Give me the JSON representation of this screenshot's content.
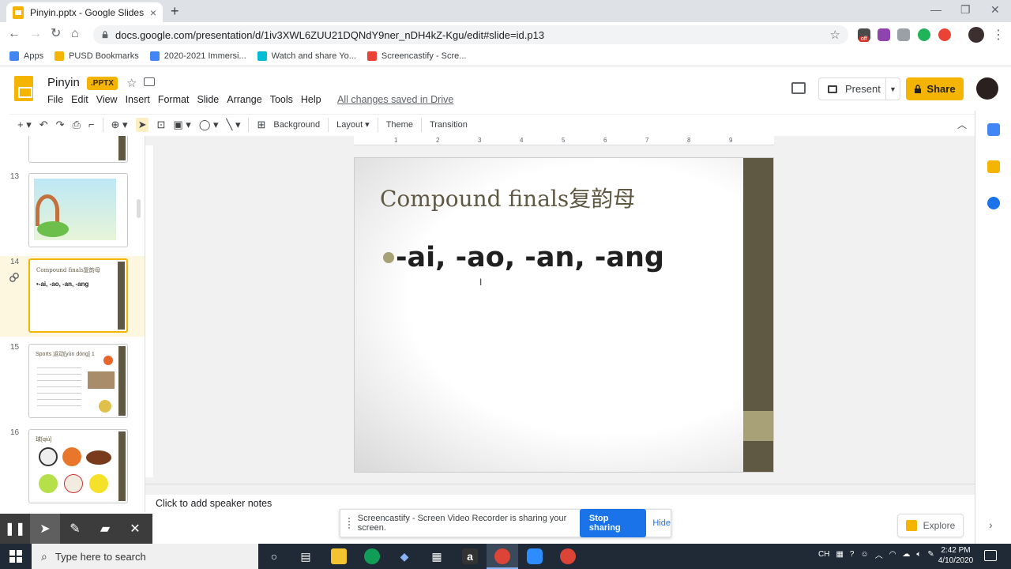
{
  "browser": {
    "tab_title": "Pinyin.pptx - Google Slides",
    "new_tab": "+",
    "url": "docs.google.com/presentation/d/1iv3XWL6ZUU21DQNdY9ner_nDH4kZ-Kgu/edit#slide=id.p13",
    "ext_badge": "off",
    "bookmarks": [
      {
        "label": "Apps",
        "color": "#4285f4"
      },
      {
        "label": "PUSD Bookmarks",
        "color": "#f4b400"
      },
      {
        "label": "2020-2021 Immersi...",
        "color": "#4285f4"
      },
      {
        "label": "Watch and share Yo...",
        "color": "#00bcd4"
      },
      {
        "label": "Screencastify - Scre...",
        "color": "#ea4335"
      }
    ]
  },
  "doc": {
    "title": "Pinyin",
    "format_badge": ".PPTX",
    "menu": [
      "File",
      "Edit",
      "View",
      "Insert",
      "Format",
      "Slide",
      "Arrange",
      "Tools",
      "Help"
    ],
    "saved_status": "All changes saved in Drive",
    "present_label": "Present",
    "share_label": "Share"
  },
  "toolbar": {
    "background_label": "Background",
    "layout_label": "Layout",
    "theme_label": "Theme",
    "transition_label": "Transition"
  },
  "ruler_ticks": [
    "1",
    "2",
    "3",
    "4",
    "5",
    "6",
    "7",
    "8",
    "9"
  ],
  "filmstrip": [
    {
      "number": "",
      "kind": "partial"
    },
    {
      "number": "13",
      "kind": "poem"
    },
    {
      "number": "14",
      "kind": "current",
      "title": "Compound finals复韵母",
      "bullet": "•-ai, -ao, -an, -ang"
    },
    {
      "number": "15",
      "kind": "sports",
      "title": "Sports 运动[yùn dòng] 1"
    },
    {
      "number": "16",
      "kind": "balls",
      "title": "球[qiú]"
    }
  ],
  "slide": {
    "title": "Compound finals复韵母",
    "bullet": "-ai, -ao, -an, -ang"
  },
  "notes_placeholder": "Click to add speaker notes",
  "screencastify": {
    "message": "Screencastify - Screen Video Recorder is sharing your screen.",
    "stop_label": "Stop sharing",
    "hide_label": "Hide"
  },
  "explore_label": "Explore",
  "taskbar": {
    "search_placeholder": "Type here to search",
    "tray_lang": "CH",
    "time": "2:42 PM",
    "date": "4/10/2020"
  },
  "colors": {
    "accent": "#f4b400",
    "slide_bar": "#5f5842",
    "slide_bar_light": "#a8a178",
    "blue": "#1a73e8"
  }
}
